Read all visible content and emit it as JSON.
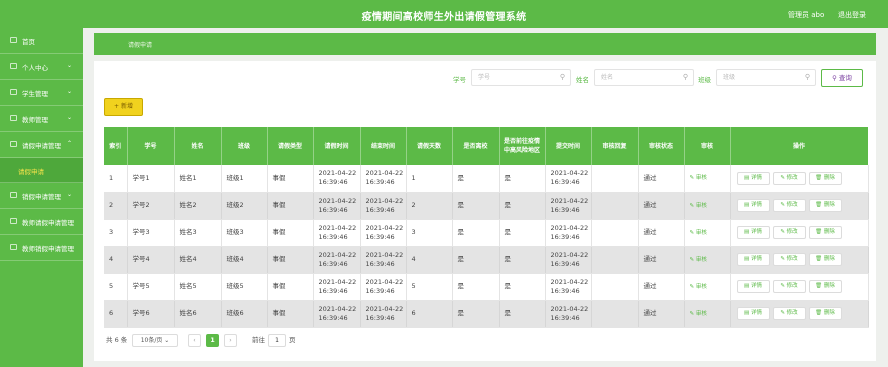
{
  "header": {
    "title": "疫情期间高校师生外出请假管理系统",
    "admin_label": "管理员 abo",
    "logout_label": "退出登录"
  },
  "sidebar": {
    "items": [
      {
        "label": "首页",
        "icon": "home-icon",
        "has_chevron": false
      },
      {
        "label": "个人中心",
        "icon": "user-icon",
        "has_chevron": true
      },
      {
        "label": "学生管理",
        "icon": "student-icon",
        "has_chevron": true
      },
      {
        "label": "教师管理",
        "icon": "teacher-icon",
        "has_chevron": true
      },
      {
        "label": "请假申请管理",
        "icon": "form-icon",
        "has_chevron": true,
        "expanded": true
      },
      {
        "label": "请假申请",
        "icon": "",
        "has_chevron": false,
        "active": true,
        "sub": true
      },
      {
        "label": "销假申请管理",
        "icon": "form-icon",
        "has_chevron": true
      },
      {
        "label": "教师请假申请管理",
        "icon": "form-icon",
        "has_chevron": false
      },
      {
        "label": "教师销假申请管理",
        "icon": "form-icon",
        "has_chevron": false
      }
    ]
  },
  "breadcrumb": {
    "text": "请假申请"
  },
  "search": {
    "student_no_label": "学号",
    "student_no_placeholder": "学号",
    "name_label": "姓名",
    "name_placeholder": "姓名",
    "class_label": "班级",
    "class_placeholder": "班级",
    "query_label": "查询"
  },
  "toolbar": {
    "add_label": "+ 新增"
  },
  "table": {
    "headers": [
      "索引",
      "学号",
      "姓名",
      "班级",
      "请假类型",
      "请假时间",
      "结束时间",
      "请假天数",
      "是否离校",
      "是否前往疫情中高风险地区",
      "提交时间",
      "审核回复",
      "审核状态",
      "审核",
      "操作"
    ],
    "rows": [
      {
        "index": "1",
        "student_no": "学号1",
        "name": "姓名1",
        "class": "班级1",
        "type": "事假",
        "start": "2021-04-22 16:39:46",
        "end": "2021-04-22 16:39:46",
        "days": "1",
        "leave_school": "是",
        "risk_area": "是",
        "submit": "2021-04-22 16:39:46",
        "reply": "",
        "status": "通过"
      },
      {
        "index": "2",
        "student_no": "学号2",
        "name": "姓名2",
        "class": "班级2",
        "type": "事假",
        "start": "2021-04-22 16:39:46",
        "end": "2021-04-22 16:39:46",
        "days": "2",
        "leave_school": "是",
        "risk_area": "是",
        "submit": "2021-04-22 16:39:46",
        "reply": "",
        "status": "通过"
      },
      {
        "index": "3",
        "student_no": "学号3",
        "name": "姓名3",
        "class": "班级3",
        "type": "事假",
        "start": "2021-04-22 16:39:46",
        "end": "2021-04-22 16:39:46",
        "days": "3",
        "leave_school": "是",
        "risk_area": "是",
        "submit": "2021-04-22 16:39:46",
        "reply": "",
        "status": "通过"
      },
      {
        "index": "4",
        "student_no": "学号4",
        "name": "姓名4",
        "class": "班级4",
        "type": "事假",
        "start": "2021-04-22 16:39:46",
        "end": "2021-04-22 16:39:46",
        "days": "4",
        "leave_school": "是",
        "risk_area": "是",
        "submit": "2021-04-22 16:39:46",
        "reply": "",
        "status": "通过"
      },
      {
        "index": "5",
        "student_no": "学号5",
        "name": "姓名5",
        "class": "班级5",
        "type": "事假",
        "start": "2021-04-22 16:39:46",
        "end": "2021-04-22 16:39:46",
        "days": "5",
        "leave_school": "是",
        "risk_area": "是",
        "submit": "2021-04-22 16:39:46",
        "reply": "",
        "status": "通过"
      },
      {
        "index": "6",
        "student_no": "学号6",
        "name": "姓名6",
        "class": "班级6",
        "type": "事假",
        "start": "2021-04-22 16:39:46",
        "end": "2021-04-22 16:39:46",
        "days": "6",
        "leave_school": "是",
        "risk_area": "是",
        "submit": "2021-04-22 16:39:46",
        "reply": "",
        "status": "通过"
      }
    ],
    "audit_label": "审核",
    "detail_label": "详情",
    "edit_label": "修改",
    "delete_label": "删除"
  },
  "pagination": {
    "total": "共 6 条",
    "page_size": "10条/页",
    "prev": "‹",
    "current": "1",
    "next": "›",
    "goto_label": "前往",
    "goto_value": "1",
    "page_unit": "页"
  },
  "colors": {
    "primary": "#5cba47",
    "accent_yellow": "#f1d21e",
    "active_menu_text": "#f4e24a"
  }
}
